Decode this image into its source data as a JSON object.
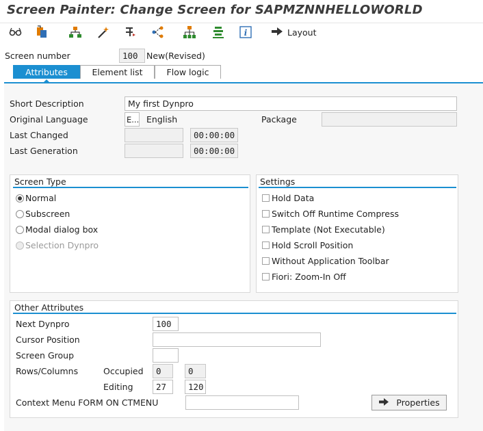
{
  "window": {
    "title": "Screen Painter: Change Screen for SAPMZNNHELLOWORLD"
  },
  "toolbar": {
    "icons": [
      "glasses-icon",
      "object-list-icon",
      "hierarchy-icon",
      "magic-wand-icon",
      "where-used-icon",
      "branch-icon",
      "tree-icon",
      "list-icon",
      "info-icon"
    ],
    "layout_label": "Layout"
  },
  "header": {
    "screen_number_label": "Screen number",
    "screen_number": "100",
    "status": "New(Revised)"
  },
  "tabs": [
    {
      "label": "Attributes",
      "active": true
    },
    {
      "label": "Element list",
      "active": false
    },
    {
      "label": "Flow logic",
      "active": false
    }
  ],
  "attributes": {
    "short_description_label": "Short Description",
    "short_description": "My first Dynpro",
    "original_language_label": "Original Language",
    "language_code": "E...",
    "language_name": "English",
    "package_label": "Package",
    "package": "",
    "last_changed_label": "Last Changed",
    "last_changed_date": "",
    "last_changed_time": "00:00:00",
    "last_generation_label": "Last Generation",
    "last_generation_date": "",
    "last_generation_time": "00:00:00"
  },
  "screen_type": {
    "title": "Screen Type",
    "options": [
      {
        "label": "Normal",
        "selected": true,
        "disabled": false
      },
      {
        "label": "Subscreen",
        "selected": false,
        "disabled": false
      },
      {
        "label": "Modal dialog box",
        "selected": false,
        "disabled": false
      },
      {
        "label": "Selection Dynpro",
        "selected": false,
        "disabled": true
      }
    ]
  },
  "settings": {
    "title": "Settings",
    "options": [
      {
        "label": "Hold Data",
        "checked": false
      },
      {
        "label": "Switch Off Runtime Compress",
        "checked": false
      },
      {
        "label": "Template (Not Executable)",
        "checked": false
      },
      {
        "label": "Hold Scroll Position",
        "checked": false
      },
      {
        "label": "Without Application Toolbar",
        "checked": false
      },
      {
        "label": "Fiori: Zoom-In Off",
        "checked": false
      }
    ]
  },
  "other_attributes": {
    "title": "Other Attributes",
    "next_dynpro_label": "Next Dynpro",
    "next_dynpro": "100",
    "cursor_position_label": "Cursor Position",
    "cursor_position": "",
    "screen_group_label": "Screen Group",
    "screen_group": "",
    "rows_columns_label": "Rows/Columns",
    "occupied_label": "Occupied",
    "occupied_rows": "0",
    "occupied_cols": "0",
    "editing_label": "Editing",
    "editing_rows": "27",
    "editing_cols": "120",
    "context_menu_label": "Context Menu FORM ON CTMENU",
    "context_menu": "",
    "properties_label": "Properties"
  },
  "colors": {
    "accent": "#1b8fd1",
    "icon_green": "#2e8b2e",
    "icon_orange": "#e07b00"
  }
}
